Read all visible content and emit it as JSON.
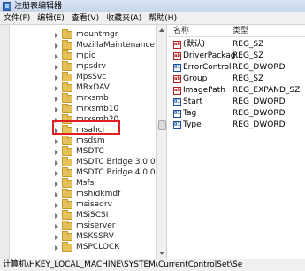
{
  "window": {
    "title": "注册表编辑器"
  },
  "menu": [
    {
      "label": "文件(F)"
    },
    {
      "label": "编辑(E)"
    },
    {
      "label": "查看(V)"
    },
    {
      "label": "收藏夹(A)"
    },
    {
      "label": "帮助(H)"
    }
  ],
  "tree": {
    "items": [
      {
        "label": "mountmgr"
      },
      {
        "label": "MozillaMaintenance"
      },
      {
        "label": "mpio"
      },
      {
        "label": "mpsdrv"
      },
      {
        "label": "MpsSvc"
      },
      {
        "label": "MRxDAV"
      },
      {
        "label": "mrxsmb"
      },
      {
        "label": "mrxsmb10"
      },
      {
        "label": "mrxsmb20"
      },
      {
        "label": "msahci",
        "selected": true
      },
      {
        "label": "msdsm"
      },
      {
        "label": "MSDTC"
      },
      {
        "label": "MSDTC Bridge 3.0.0.0"
      },
      {
        "label": "MSDTC Bridge 4.0.0.0"
      },
      {
        "label": "Msfs"
      },
      {
        "label": "mshidkmdf"
      },
      {
        "label": "msisadrv"
      },
      {
        "label": "MSiSCSI"
      },
      {
        "label": "msiserver"
      },
      {
        "label": "MSKSSRV"
      },
      {
        "label": "MSPCLOCK"
      }
    ]
  },
  "values": {
    "headers": {
      "name": "名称",
      "type": "类型"
    },
    "rows": [
      {
        "icon": "ab",
        "name": "(默认)",
        "type": "REG_SZ"
      },
      {
        "icon": "ab",
        "name": "DriverPackag...",
        "type": "REG_SZ"
      },
      {
        "icon": "01",
        "name": "ErrorControl",
        "type": "REG_DWORD"
      },
      {
        "icon": "ab",
        "name": "Group",
        "type": "REG_SZ"
      },
      {
        "icon": "ab",
        "name": "ImagePath",
        "type": "REG_EXPAND_SZ"
      },
      {
        "icon": "01",
        "name": "Start",
        "type": "REG_DWORD"
      },
      {
        "icon": "01",
        "name": "Tag",
        "type": "REG_DWORD"
      },
      {
        "icon": "01",
        "name": "Type",
        "type": "REG_DWORD"
      }
    ]
  },
  "status": {
    "path": "计算机\\HKEY_LOCAL_MACHINE\\SYSTEM\\CurrentControlSet\\Se"
  },
  "colors": {
    "selection_outline": "#e02020",
    "folder": "#e6c15a"
  }
}
